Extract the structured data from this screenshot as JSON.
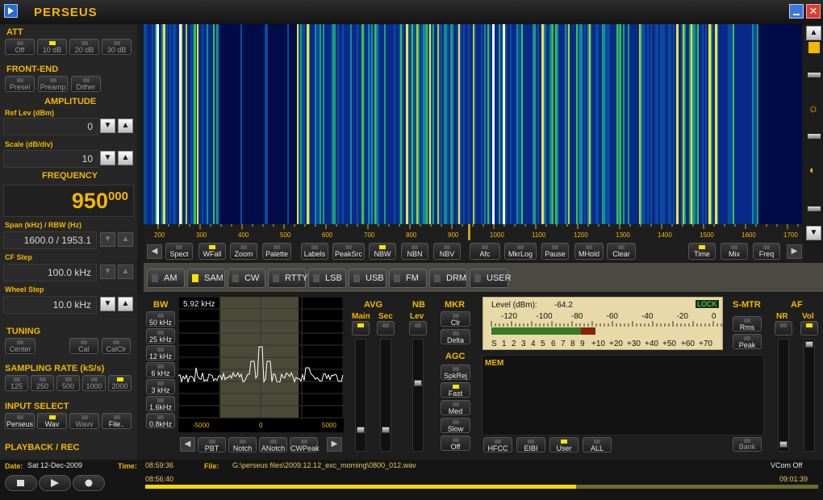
{
  "app": {
    "title": "PERSEUS"
  },
  "att": {
    "title": "ATT",
    "buttons": [
      {
        "label": "Off",
        "on": false
      },
      {
        "label": "10 dB",
        "on": true
      },
      {
        "label": "20 dB",
        "on": false
      },
      {
        "label": "30 dB",
        "on": false
      }
    ]
  },
  "frontend": {
    "title": "FRONT-END",
    "buttons": [
      {
        "label": "Presel"
      },
      {
        "label": "Preamp"
      },
      {
        "label": "Dither"
      }
    ]
  },
  "amplitude": {
    "title": "AMPLITUDE",
    "ref_label": "Ref Lev (dBm)",
    "ref_value": "0",
    "scale_label": "Scale (dB/div)",
    "scale_value": "10"
  },
  "frequency": {
    "title": "FREQUENCY",
    "main": "950",
    "sub": "000",
    "span_label": "Span (kHz) / RBW (Hz)",
    "span_value": "1600.0 / 1953.1",
    "cf_label": "CF Step",
    "cf_value": "100.0 kHz",
    "wheel_label": "Wheel Step",
    "wheel_value": "10.0 kHz"
  },
  "tuning": {
    "title": "TUNING",
    "buttons": [
      "Center",
      "Cal",
      "CalClr"
    ]
  },
  "sampling": {
    "title": "SAMPLING RATE (kS/s)",
    "buttons": [
      {
        "label": "125",
        "on": false
      },
      {
        "label": "250",
        "on": false
      },
      {
        "label": "500",
        "on": false
      },
      {
        "label": "1000",
        "on": false
      },
      {
        "label": "2000",
        "on": true
      }
    ]
  },
  "input": {
    "title": "INPUT SELECT",
    "buttons": [
      {
        "label": "Perseus",
        "on": false
      },
      {
        "label": "Wav",
        "on": true
      },
      {
        "label": "Wavv",
        "on": false
      },
      {
        "label": "File..",
        "on": false
      }
    ]
  },
  "playback": {
    "title": "PLAYBACK / REC"
  },
  "status": {
    "date_label": "Date:",
    "date": "Sat 12-Dec-2009",
    "time_label": "Time:",
    "time": "08:59:36",
    "file_label": "File:",
    "file": "G:\\perseus files\\2009.12.12_exc_morning\\0800_012.wav",
    "vcom": "VCom Off",
    "pos_start": "08:56:40",
    "pos_end": "09:01:39",
    "progress": 0.64
  },
  "freq_axis": [
    "200",
    "300",
    "400",
    "500",
    "600",
    "700",
    "800",
    "900",
    "1000",
    "1100",
    "1200",
    "1300",
    "1400",
    "1500",
    "1600",
    "1700"
  ],
  "toolbar": [
    {
      "label": "Spect",
      "on": false
    },
    {
      "label": "WFall",
      "on": true
    },
    {
      "label": "Zoom",
      "on": false
    },
    {
      "label": "Palette",
      "on": false
    },
    {
      "label": "Labels",
      "on": false
    },
    {
      "label": "PeakSrc",
      "on": false
    },
    {
      "label": "NBW",
      "on": true
    },
    {
      "label": "NBN",
      "on": false
    },
    {
      "label": "NBV",
      "on": false
    },
    {
      "label": "Afc",
      "on": false
    },
    {
      "label": "MkrLog",
      "on": false
    },
    {
      "label": "Pause",
      "on": false
    },
    {
      "label": "MHold",
      "on": false
    },
    {
      "label": "Clear",
      "on": false
    },
    {
      "label": "Time",
      "on": true
    },
    {
      "label": "Mix",
      "on": false
    },
    {
      "label": "Freq",
      "on": false
    }
  ],
  "modes": [
    {
      "label": "AM",
      "on": false
    },
    {
      "label": "SAM",
      "on": true
    },
    {
      "label": "CW",
      "on": false
    },
    {
      "label": "RTTY",
      "on": false
    },
    {
      "label": "LSB",
      "on": false
    },
    {
      "label": "USB",
      "on": false
    },
    {
      "label": "FM",
      "on": false
    },
    {
      "label": "DRM",
      "on": false
    },
    {
      "label": "USER",
      "on": false
    }
  ],
  "bw": {
    "title": "BW",
    "buttons": [
      "50 kHz",
      "25 kHz",
      "12 kHz",
      "6 kHz",
      "3 kHz",
      "1.6kHz",
      "0.8kHz"
    ],
    "value": "5.92 kHz",
    "axis": [
      "-5000",
      "0",
      "5000"
    ],
    "bottom": [
      "PBT",
      "Notch",
      "ANotch",
      "CWPeak"
    ]
  },
  "avg": {
    "title": "AVG",
    "main": "Main",
    "sec": "Sec"
  },
  "nb": {
    "title": "NB",
    "lev": "Lev"
  },
  "mkr": {
    "title": "MKR",
    "buttons": [
      "Clr",
      "Delta"
    ]
  },
  "agc": {
    "title": "AGC",
    "buttons": [
      "SpkRej",
      "Fast",
      "Med",
      "Slow",
      "Off"
    ]
  },
  "level": {
    "label": "Level (dBm):",
    "value": "-64.2",
    "lock": "LOCK",
    "dbm_scale": [
      "-120",
      "-100",
      "-80",
      "-60",
      "-40",
      "-20",
      "0"
    ],
    "s_scale": [
      "S",
      "1",
      "2",
      "3",
      "4",
      "5",
      "6",
      "7",
      "8",
      "9",
      "+10",
      "+20",
      "+30",
      "+40",
      "+50",
      "+60",
      "+70"
    ],
    "fraction": 0.46
  },
  "smtr": {
    "title": "S-MTR",
    "buttons": [
      "Rms",
      "Peak"
    ]
  },
  "af": {
    "title": "AF",
    "nr": "NR",
    "vol": "Vol"
  },
  "mem": {
    "title": "MEM",
    "buttons": [
      "HFCC",
      "EIBI",
      "User",
      "ALL"
    ],
    "bank": "Bank"
  },
  "colors": {
    "accent": "#f3b700",
    "waterfall_bg": "#000c48"
  }
}
